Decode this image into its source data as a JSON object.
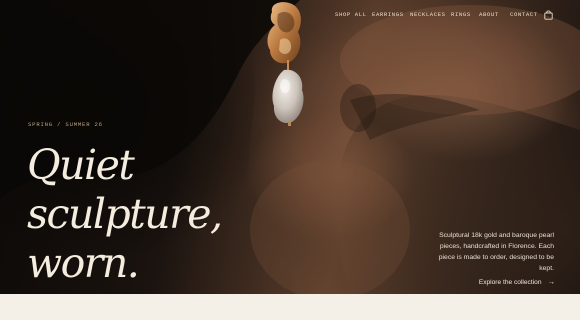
{
  "nav": {
    "items": [
      "SHOP ALL",
      "EARRINGS",
      "NECKLACES",
      "RINGS",
      "ABOUT",
      "CONTACT"
    ],
    "bag_icon": "shopping-bag-icon"
  },
  "hero": {
    "season": "SPRING / SUMMER 26",
    "headline": [
      "Quiet",
      "sculpture,",
      "worn."
    ],
    "description": "Sculptural 18k gold and baroque pearl pieces, handcrafted in Florence. Each piece is made to order, designed to be kept.",
    "cta_label": "Explore the collection",
    "cta_icon": "arrow-right-icon"
  },
  "colors": {
    "headline": "#f4ecde",
    "accent": "#bfa383",
    "footer_band": "#f4efe7"
  }
}
